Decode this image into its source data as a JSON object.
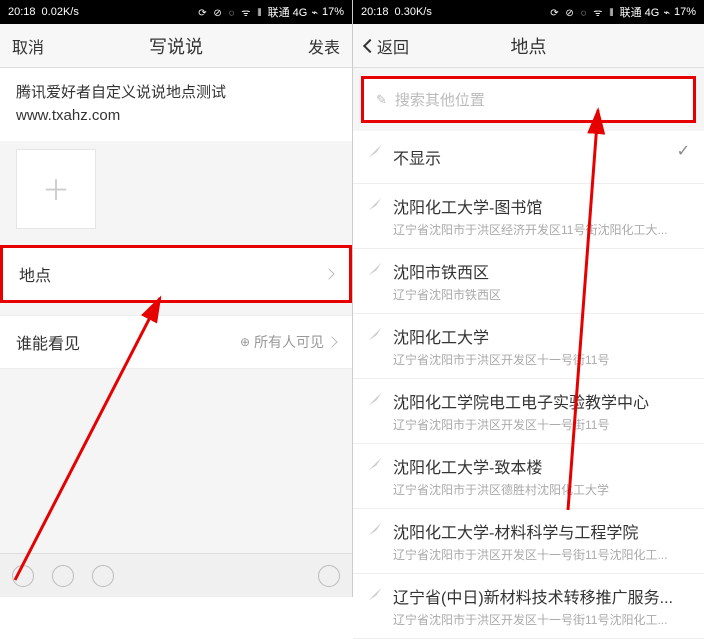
{
  "left": {
    "status": {
      "time": "20:18",
      "speed": "0.02K/s",
      "carrier": "联通 4G",
      "battery": "17%"
    },
    "nav": {
      "cancel": "取消",
      "title": "写说说",
      "publish": "发表"
    },
    "compose": {
      "line1": "腾讯爱好者自定义说说地点测试",
      "line2": "www.txahz.com"
    },
    "rows": {
      "location_label": "地点",
      "visibility_label": "谁能看见",
      "visibility_value": "所有人可见"
    }
  },
  "right": {
    "status": {
      "time": "20:18",
      "speed": "0.30K/s",
      "carrier": "联通 4G",
      "battery": "17%"
    },
    "nav": {
      "back": "返回",
      "title": "地点"
    },
    "search": {
      "placeholder": "搜索其他位置"
    },
    "items": [
      {
        "title": "不显示",
        "sub": "",
        "checked": true
      },
      {
        "title": "沈阳化工大学-图书馆",
        "sub": "辽宁省沈阳市于洪区经济开发区11号街沈阳化工大..."
      },
      {
        "title": "沈阳市铁西区",
        "sub": "辽宁省沈阳市铁西区"
      },
      {
        "title": "沈阳化工大学",
        "sub": "辽宁省沈阳市于洪区开发区十一号街11号"
      },
      {
        "title": "沈阳化工学院电工电子实验教学中心",
        "sub": "辽宁省沈阳市于洪区开发区十一号街11号"
      },
      {
        "title": "沈阳化工大学-致本楼",
        "sub": "辽宁省沈阳市于洪区德胜村沈阳化工大学"
      },
      {
        "title": "沈阳化工大学-材料科学与工程学院",
        "sub": "辽宁省沈阳市于洪区开发区十一号街11号沈阳化工..."
      },
      {
        "title": "辽宁省(中日)新材料技术转移推广服务...",
        "sub": "辽宁省沈阳市于洪区开发区十一号街11号沈阳化工..."
      }
    ]
  }
}
